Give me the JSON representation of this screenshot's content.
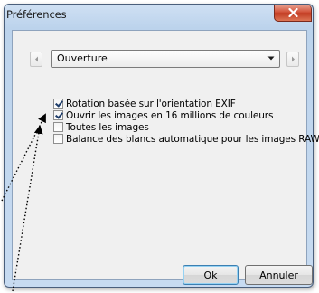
{
  "window": {
    "title": "Préférences",
    "close_label": "×"
  },
  "category": {
    "selected": "Ouverture",
    "options": [
      "Ouverture"
    ]
  },
  "options": [
    {
      "label": "Rotation basée sur l'orientation EXIF",
      "checked": true
    },
    {
      "label": "Ouvrir les images en 16 millions de couleurs",
      "checked": true
    },
    {
      "label": "Toutes les images",
      "checked": false
    },
    {
      "label": "Balance des blancs automatique pour les images RAW",
      "checked": false
    }
  ],
  "buttons": {
    "ok": "Ok",
    "cancel": "Annuler"
  },
  "icons": {
    "close": "close-icon",
    "prev": "chevron-left-icon",
    "next": "chevron-right-icon",
    "dropdown": "chevron-down-icon"
  }
}
